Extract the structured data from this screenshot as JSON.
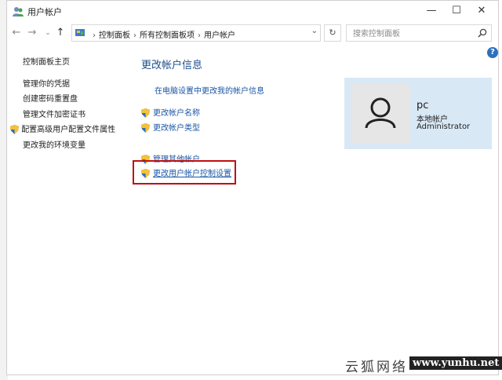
{
  "window": {
    "title": "用户帐户",
    "controls": {
      "minimize": "—",
      "maximize": "☐",
      "close": "✕"
    }
  },
  "address": {
    "crumbs": [
      "控制面板",
      "所有控制面板项",
      "用户帐户"
    ],
    "search_placeholder": "搜索控制面板"
  },
  "sidebar": {
    "items": [
      "控制面板主页",
      "管理你的凭据",
      "创建密码重置盘",
      "管理文件加密证书",
      "配置高级用户配置文件属性",
      "更改我的环境变量"
    ]
  },
  "main": {
    "title": "更改帐户信息",
    "links": [
      "在电脑设置中更改我的帐户信息",
      "更改帐户名称",
      "更改帐户类型",
      "管理其他帐户",
      "更改用户帐户控制设置"
    ]
  },
  "user": {
    "name": "pc",
    "type": "本地帐户",
    "group": "Administrator"
  },
  "help_label": "?",
  "watermark": {
    "cn": "云狐网络",
    "url": "www.yunhu.net"
  },
  "colors": {
    "link": "#1a56a6",
    "title": "#1e4f8c",
    "card_bg": "#d9e8f5",
    "highlight": "#c01010"
  }
}
